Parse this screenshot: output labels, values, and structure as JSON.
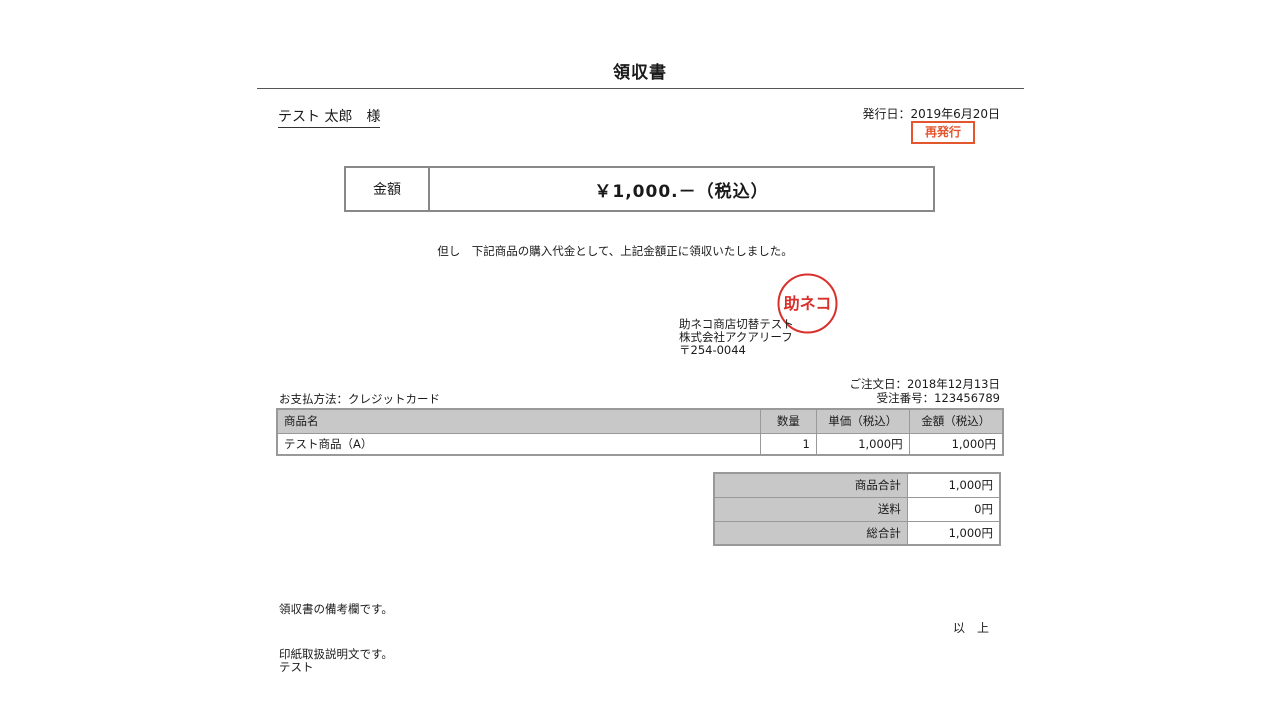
{
  "document": {
    "title": "領収書",
    "customer_name": "テスト 太郎　様",
    "issue_date_label": "発行日：",
    "issue_date": "2019年6月20日",
    "reissue_badge": "再発行",
    "amount_label": "金額",
    "amount_value": "￥1,000.－（税込）",
    "proviso": "但し　下記商品の購入代金として、上記金額正に領収いたしました。",
    "seal_text": "助ネコ",
    "seal_color": "#d9302c",
    "shop": {
      "name": "助ネコ商店切替テスト",
      "company": "株式会社アクアリーフ",
      "postal": "〒254-0044"
    },
    "payment_method": "お支払方法：クレジットカード",
    "order_date": "ご注文日：2018年12月13日",
    "order_number": "受注番号：123456789"
  },
  "items_table": {
    "headers": [
      "商品名",
      "数量",
      "単価（税込）",
      "金額（税込）"
    ],
    "rows": [
      {
        "name": "テスト商品（A）",
        "qty": "1",
        "unit_price": "1,000円",
        "amount": "1,000円"
      }
    ]
  },
  "totals": [
    {
      "label": "商品合計",
      "value": "1,000円"
    },
    {
      "label": "送料",
      "value": "0円"
    },
    {
      "label": "総合計",
      "value": "1,000円"
    }
  ],
  "footer": {
    "remarks": "領収書の備考欄です。",
    "ijo": "以　上",
    "stamp_note_line1": "印紙取扱説明文です。",
    "stamp_note_line2": "テスト"
  },
  "colors": {
    "accent_red": "#e4572e",
    "header_gray": "#c8c8c8"
  }
}
